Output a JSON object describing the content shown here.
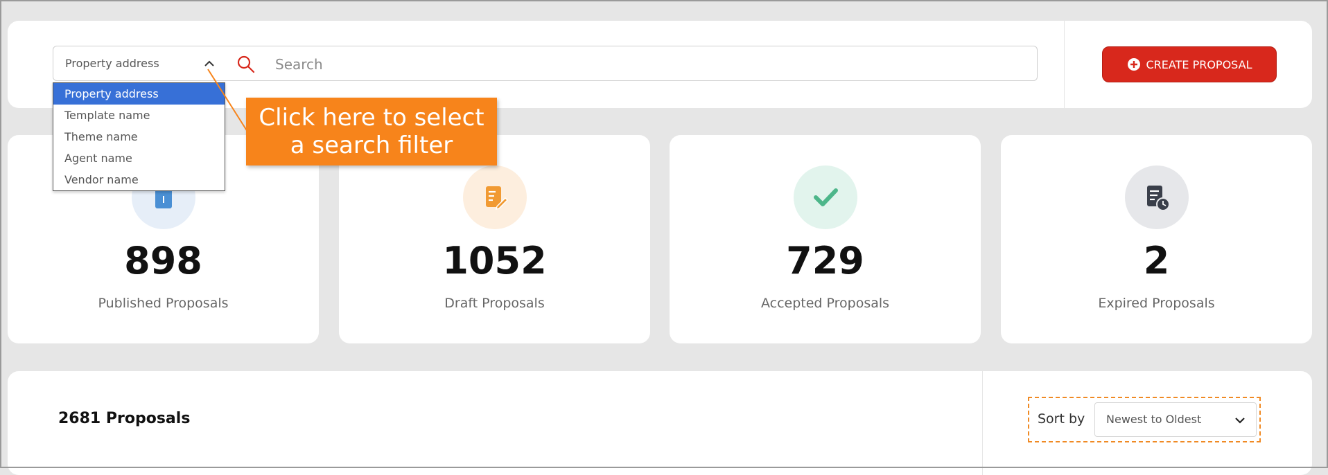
{
  "search": {
    "filter_selected": "Property address",
    "placeholder": "Search",
    "filter_options": [
      "Property address",
      "Template name",
      "Theme name",
      "Agent name",
      "Vendor name"
    ]
  },
  "create_button": {
    "label": "CREATE PROPOSAL",
    "color": "#d8281c"
  },
  "callout": {
    "line1": "Click here to select",
    "line2": "a search filter",
    "color": "#f7841b"
  },
  "stats": [
    {
      "value": "898",
      "label": "Published Proposals",
      "icon": "publish-icon",
      "color": "#4a8fd4"
    },
    {
      "value": "1052",
      "label": "Draft Proposals",
      "icon": "draft-edit-icon",
      "color": "#f19a33"
    },
    {
      "value": "729",
      "label": "Accepted Proposals",
      "icon": "checkmark-icon",
      "color": "#4db68a"
    },
    {
      "value": "2",
      "label": "Expired Proposals",
      "icon": "document-clock-icon",
      "color": "#3a3f4a"
    }
  ],
  "list": {
    "count_title": "2681 Proposals",
    "sort_label": "Sort by",
    "sort_value": "Newest to Oldest"
  }
}
